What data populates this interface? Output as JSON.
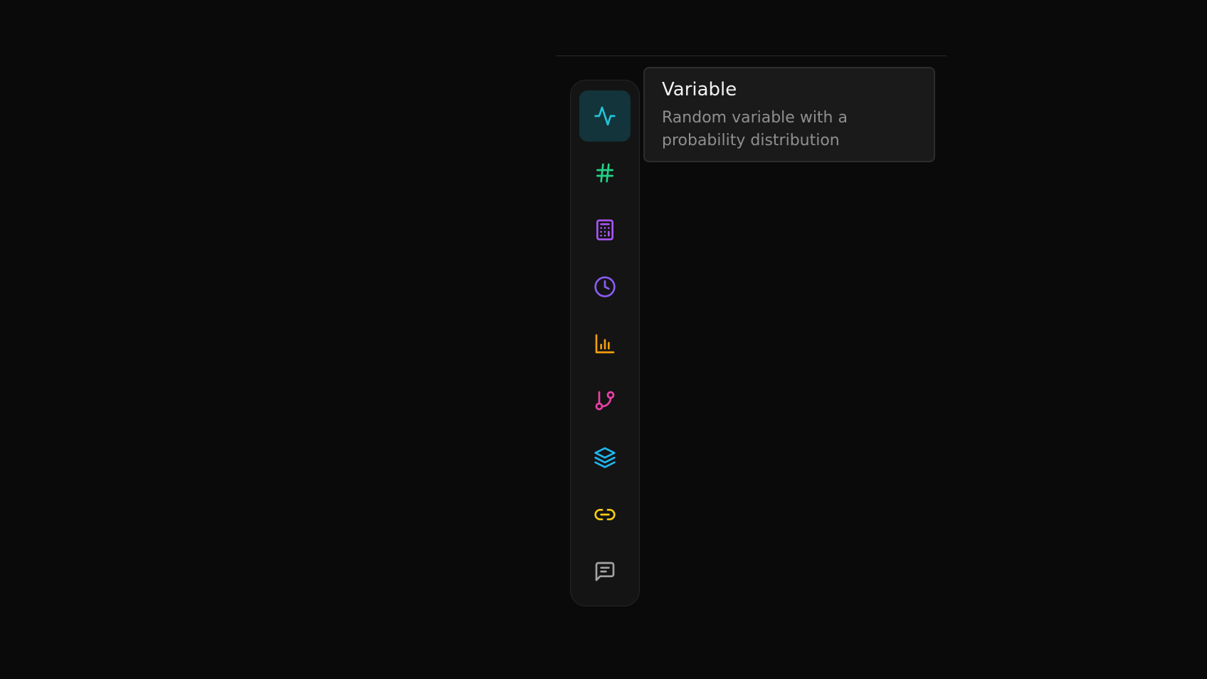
{
  "toolbar": {
    "items": [
      {
        "icon": "activity-icon",
        "color": "#22c5d9",
        "active": true
      },
      {
        "icon": "hash-icon",
        "color": "#22d386",
        "active": false
      },
      {
        "icon": "calculator-icon",
        "color": "#a855f7",
        "active": false
      },
      {
        "icon": "clock-icon",
        "color": "#8b5cf6",
        "active": false
      },
      {
        "icon": "bar-chart-icon",
        "color": "#f59e0b",
        "active": false
      },
      {
        "icon": "git-branch-icon",
        "color": "#ec3fa6",
        "active": false
      },
      {
        "icon": "layers-icon",
        "color": "#22b5f0",
        "active": false
      },
      {
        "icon": "link-icon",
        "color": "#facc15",
        "active": false
      },
      {
        "icon": "message-icon",
        "color": "#a3a3a3",
        "active": false
      }
    ]
  },
  "tooltip": {
    "title": "Variable",
    "description": "Random variable with a probability distribution"
  }
}
